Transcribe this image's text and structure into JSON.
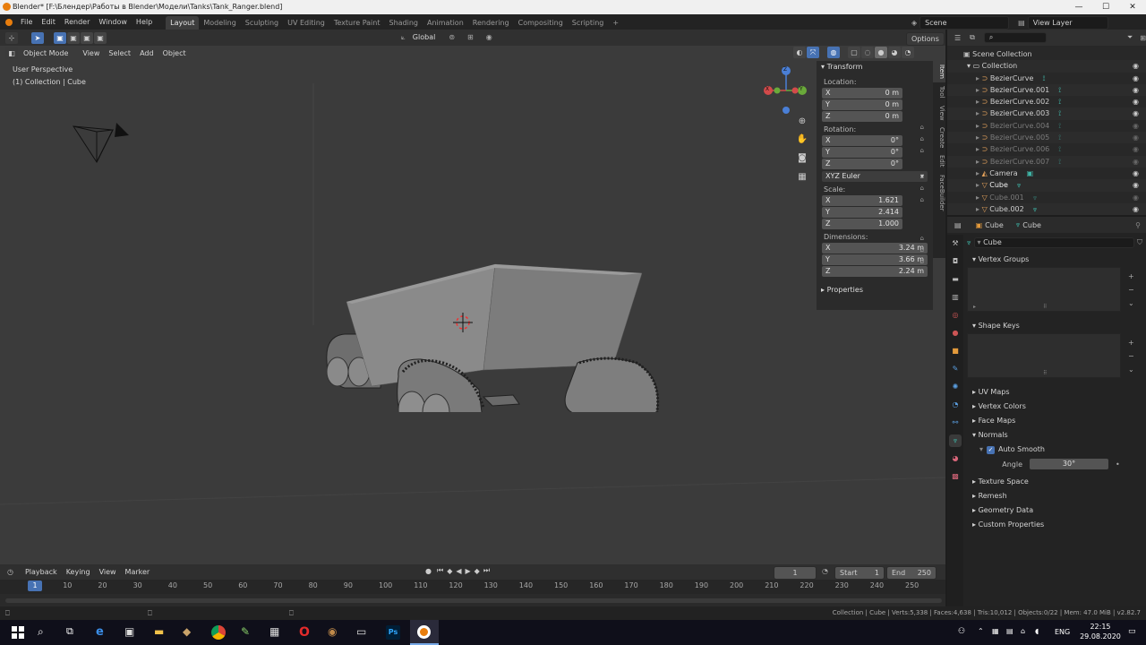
{
  "titlebar": {
    "title": "Blender* [F:\\Блендер\\Работы в Blender\\Модели\\Tanks\\Tank_Ranger.blend]",
    "min": "—",
    "max": "☐",
    "close": "✕"
  },
  "menu": {
    "items": [
      "File",
      "Edit",
      "Render",
      "Window",
      "Help"
    ],
    "workspaces": [
      "Layout",
      "Modeling",
      "Sculpting",
      "UV Editing",
      "Texture Paint",
      "Shading",
      "Animation",
      "Rendering",
      "Compositing",
      "Scripting"
    ],
    "active_workspace": "Layout",
    "add_tab": "+",
    "scene_label": "Scene",
    "view_layer_label": "View Layer"
  },
  "viewport": {
    "transform_orientation": "Global",
    "options_label": "Options",
    "mode": "Object Mode",
    "header_menu": [
      "View",
      "Select",
      "Add",
      "Object"
    ],
    "perspective_label": "User Perspective",
    "collection_label": "(1) Collection | Cube",
    "gizmo": {
      "z": "Z",
      "x": "X",
      "y": "Y"
    }
  },
  "npanel": {
    "transform_title": "Transform",
    "location_label": "Location:",
    "location": [
      {
        "axis": "X",
        "value": "0 m"
      },
      {
        "axis": "Y",
        "value": "0 m"
      },
      {
        "axis": "Z",
        "value": "0 m"
      }
    ],
    "rotation_label": "Rotation:",
    "rotation": [
      {
        "axis": "X",
        "value": "0°"
      },
      {
        "axis": "Y",
        "value": "0°"
      },
      {
        "axis": "Z",
        "value": "0°"
      }
    ],
    "rotation_mode": "XYZ Euler",
    "scale_label": "Scale:",
    "scale": [
      {
        "axis": "X",
        "value": "1.621"
      },
      {
        "axis": "Y",
        "value": "2.414"
      },
      {
        "axis": "Z",
        "value": "1.000"
      }
    ],
    "dimensions_label": "Dimensions:",
    "dimensions": [
      {
        "axis": "X",
        "value": "3.24 m"
      },
      {
        "axis": "Y",
        "value": "3.66 m"
      },
      {
        "axis": "Z",
        "value": "2.24 m"
      }
    ],
    "properties_title": "Properties",
    "tabs": [
      "Item",
      "Tool",
      "View",
      "Create",
      "Edit",
      "FaceBuilder"
    ]
  },
  "outliner": {
    "search_placeholder": "",
    "scene_collection": "Scene Collection",
    "collection": "Collection",
    "items": [
      {
        "name": "BezierCurve",
        "dim": false
      },
      {
        "name": "BezierCurve.001",
        "dim": false
      },
      {
        "name": "BezierCurve.002",
        "dim": false
      },
      {
        "name": "BezierCurve.003",
        "dim": false
      },
      {
        "name": "BezierCurve.004",
        "dim": true
      },
      {
        "name": "BezierCurve.005",
        "dim": true
      },
      {
        "name": "BezierCurve.006",
        "dim": true
      },
      {
        "name": "BezierCurve.007",
        "dim": true
      },
      {
        "name": "Camera",
        "dim": false
      },
      {
        "name": "Cube",
        "dim": false
      },
      {
        "name": "Cube.001",
        "dim": true
      },
      {
        "name": "Cube.002",
        "dim": false
      }
    ]
  },
  "properties": {
    "breadcrumb_object": "Cube",
    "breadcrumb_mesh": "Cube",
    "mesh_name": "Cube",
    "sections": {
      "vertex_groups": "Vertex Groups",
      "shape_keys": "Shape Keys",
      "uv_maps": "UV Maps",
      "vertex_colors": "Vertex Colors",
      "face_maps": "Face Maps",
      "normals": "Normals",
      "auto_smooth": "Auto Smooth",
      "angle_label": "Angle",
      "angle_value": "30°",
      "texture_space": "Texture Space",
      "remesh": "Remesh",
      "geometry_data": "Geometry Data",
      "custom_properties": "Custom Properties"
    }
  },
  "timeline": {
    "menu": [
      "Playback",
      "Keying",
      "View",
      "Marker"
    ],
    "current_frame": "1",
    "start_label": "Start",
    "start_value": "1",
    "end_label": "End",
    "end_value": "250",
    "ticks": [
      "10",
      "20",
      "30",
      "40",
      "50",
      "60",
      "70",
      "80",
      "90",
      "100",
      "110",
      "120",
      "130",
      "140",
      "150",
      "160",
      "170",
      "180",
      "190",
      "200",
      "210",
      "220",
      "230",
      "240",
      "250"
    ],
    "playhead": "1"
  },
  "statusbar": {
    "text": "Collection | Cube | Verts:5,338 | Faces:4,638 | Tris:10,012 | Objects:0/22 | Mem: 47.0 MiB | v2.82.7"
  },
  "taskbar": {
    "lang": "ENG",
    "time": "22:15",
    "date": "29.08.2020",
    "ps_label": "Ps"
  },
  "colors": {
    "accent": "#4772b3",
    "orange_select": "#e87d0d",
    "viewport_bg": "#3b3b3b",
    "curve_icon": "#e8a45c",
    "mesh_icon": "#3fb4a6"
  }
}
